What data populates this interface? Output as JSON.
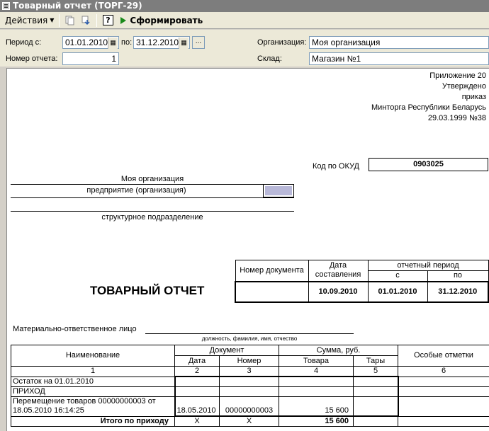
{
  "window": {
    "title": "Товарный отчет (ТОРГ-29)"
  },
  "toolbar": {
    "actions_label": "Действия",
    "help_label": "?",
    "generate_label": "Сформировать"
  },
  "form": {
    "period_from_label": "Период с:",
    "period_from_value": "01.01.2010",
    "period_to_label": "по:",
    "period_to_value": "31.12.2010",
    "dots_label": "...",
    "report_number_label": "Номер отчета:",
    "report_number_value": "1",
    "organization_label": "Организация:",
    "organization_value": "Моя организация",
    "warehouse_label": "Склад:",
    "warehouse_value": "Магазин №1"
  },
  "report": {
    "appendix_lines": [
      "Приложение 20",
      "Утверждено",
      "приказ",
      "Минторга Республики Беларусь",
      "29.03.1999 №38"
    ],
    "okud_label": "Код по ОКУД",
    "okud_value": "0903025",
    "org_name": "Моя организация",
    "org_caption": "предприятие (организация)",
    "division_caption": "структурное подразделение",
    "header_doc_number": "Номер документа",
    "header_date": "Дата составления",
    "header_period": "отчетный период",
    "header_from": "с",
    "header_to": "по",
    "doc_date": "10.09.2010",
    "period_from": "01.01.2010",
    "period_to": "31.12.2010",
    "title": "ТОВАРНЫЙ  ОТЧЕТ",
    "responsible_label": "Материально-ответственное лицо",
    "responsible_caption": "должность, фамилия, имя, отчество",
    "table": {
      "col_name": "Наименование",
      "col_document": "Документ",
      "col_date": "Дата",
      "col_number": "Номер",
      "col_sum": "Сумма, руб.",
      "col_goods": "Товара",
      "col_tare": "Тары",
      "col_notes": "Особые отметки",
      "col_nums": [
        "1",
        "2",
        "3",
        "4",
        "5",
        "6"
      ],
      "row_balance": "Остаток на 01.01.2010",
      "row_income": "ПРИХОД",
      "row_move_name": "Перемещение товаров 00000000003 от 18.05.2010 16:14:25",
      "row_move_date": "18.05.2010",
      "row_move_number": "00000000003",
      "row_move_sum": "15 600",
      "row_total_label": "Итого по приходу",
      "row_total_x1": "X",
      "row_total_x2": "X",
      "row_total_sum": "15 600"
    }
  }
}
